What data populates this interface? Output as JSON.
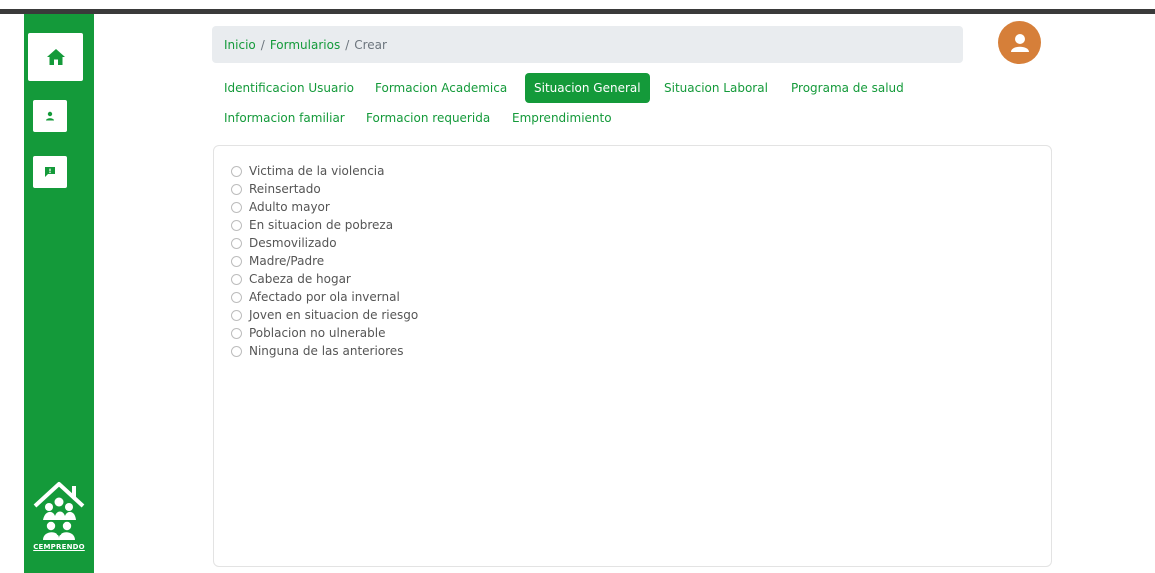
{
  "breadcrumb": {
    "items": [
      "Inicio",
      "Formularios",
      "Crear"
    ]
  },
  "tabs": [
    {
      "label": "Identificacion Usuario",
      "active": false
    },
    {
      "label": "Formacion Academica",
      "active": false
    },
    {
      "label": "Situacion General",
      "active": true
    },
    {
      "label": "Situacion Laboral",
      "active": false
    },
    {
      "label": "Programa de salud",
      "active": false
    },
    {
      "label": "Informacion familiar",
      "active": false
    },
    {
      "label": "Formacion requerida",
      "active": false
    },
    {
      "label": "Emprendimiento",
      "active": false
    }
  ],
  "options": [
    "Victima de la violencia",
    "Reinsertado",
    "Adulto mayor",
    "En situacion de pobreza",
    "Desmovilizado",
    "Madre/Padre",
    "Cabeza de hogar",
    "Afectado por ola invernal",
    "Joven en situacion de riesgo",
    "Poblacion no ulnerable",
    "Ninguna de las anteriores"
  ],
  "logo": {
    "text": "CEMPRENDO"
  },
  "colors": {
    "brand": "#149a3a",
    "avatar": "#d67f39",
    "breadcrumb_bg": "#e9ecef"
  },
  "icons": {
    "home": "home-icon",
    "user": "user-icon",
    "chat": "chat-icon",
    "avatar": "user-avatar-icon"
  }
}
